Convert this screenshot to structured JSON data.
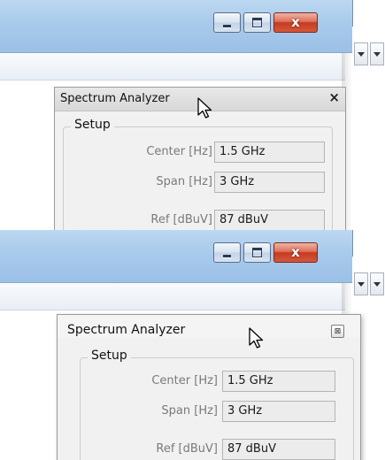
{
  "panels": [
    {
      "dialog": {
        "title": "Spectrum Analyzer",
        "close_glyph": "×",
        "group": {
          "legend": "Setup",
          "rows": [
            {
              "label": "Center [Hz]",
              "value": "1.5 GHz"
            },
            {
              "label": "Span [Hz]",
              "value": "3 GHz"
            },
            {
              "label": "Ref [dBuV]",
              "value": "87 dBuV"
            }
          ]
        }
      }
    },
    {
      "dialog": {
        "title": "Spectrum Analyzer",
        "close_glyph": "⊠",
        "group": {
          "legend": "Setup",
          "rows": [
            {
              "label": "Center [Hz]",
              "value": "1.5 GHz"
            },
            {
              "label": "Span [Hz]",
              "value": "3 GHz"
            },
            {
              "label": "Ref [dBuV]",
              "value": "87 dBuV"
            }
          ]
        }
      }
    }
  ],
  "window_caption": {
    "minimize_icon": "minimize-icon",
    "maximize_icon": "maximize-icon",
    "close_icon": "close-icon",
    "close_glyph": "x"
  },
  "colors": {
    "titlebar": "#a9cbec",
    "close_button": "#c9432a",
    "dialog_background": "#f1f1f1"
  }
}
